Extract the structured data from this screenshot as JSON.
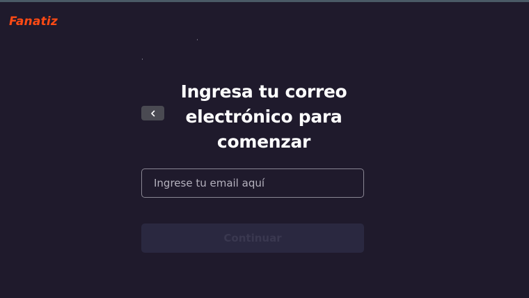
{
  "brand": {
    "logo_text": "Fanatiz",
    "accent_color": "#ff4a14"
  },
  "nav": {
    "back_icon": "chevron-left-icon"
  },
  "login": {
    "heading": "Ingresa tu correo electrónico para comenzar",
    "email_placeholder": "Ingrese tu email aquí",
    "email_value": "",
    "continue_label": "Continuar"
  },
  "colors": {
    "background": "#1f1a2c",
    "button_disabled_bg": "#2a2840",
    "input_border": "#8a8794"
  }
}
